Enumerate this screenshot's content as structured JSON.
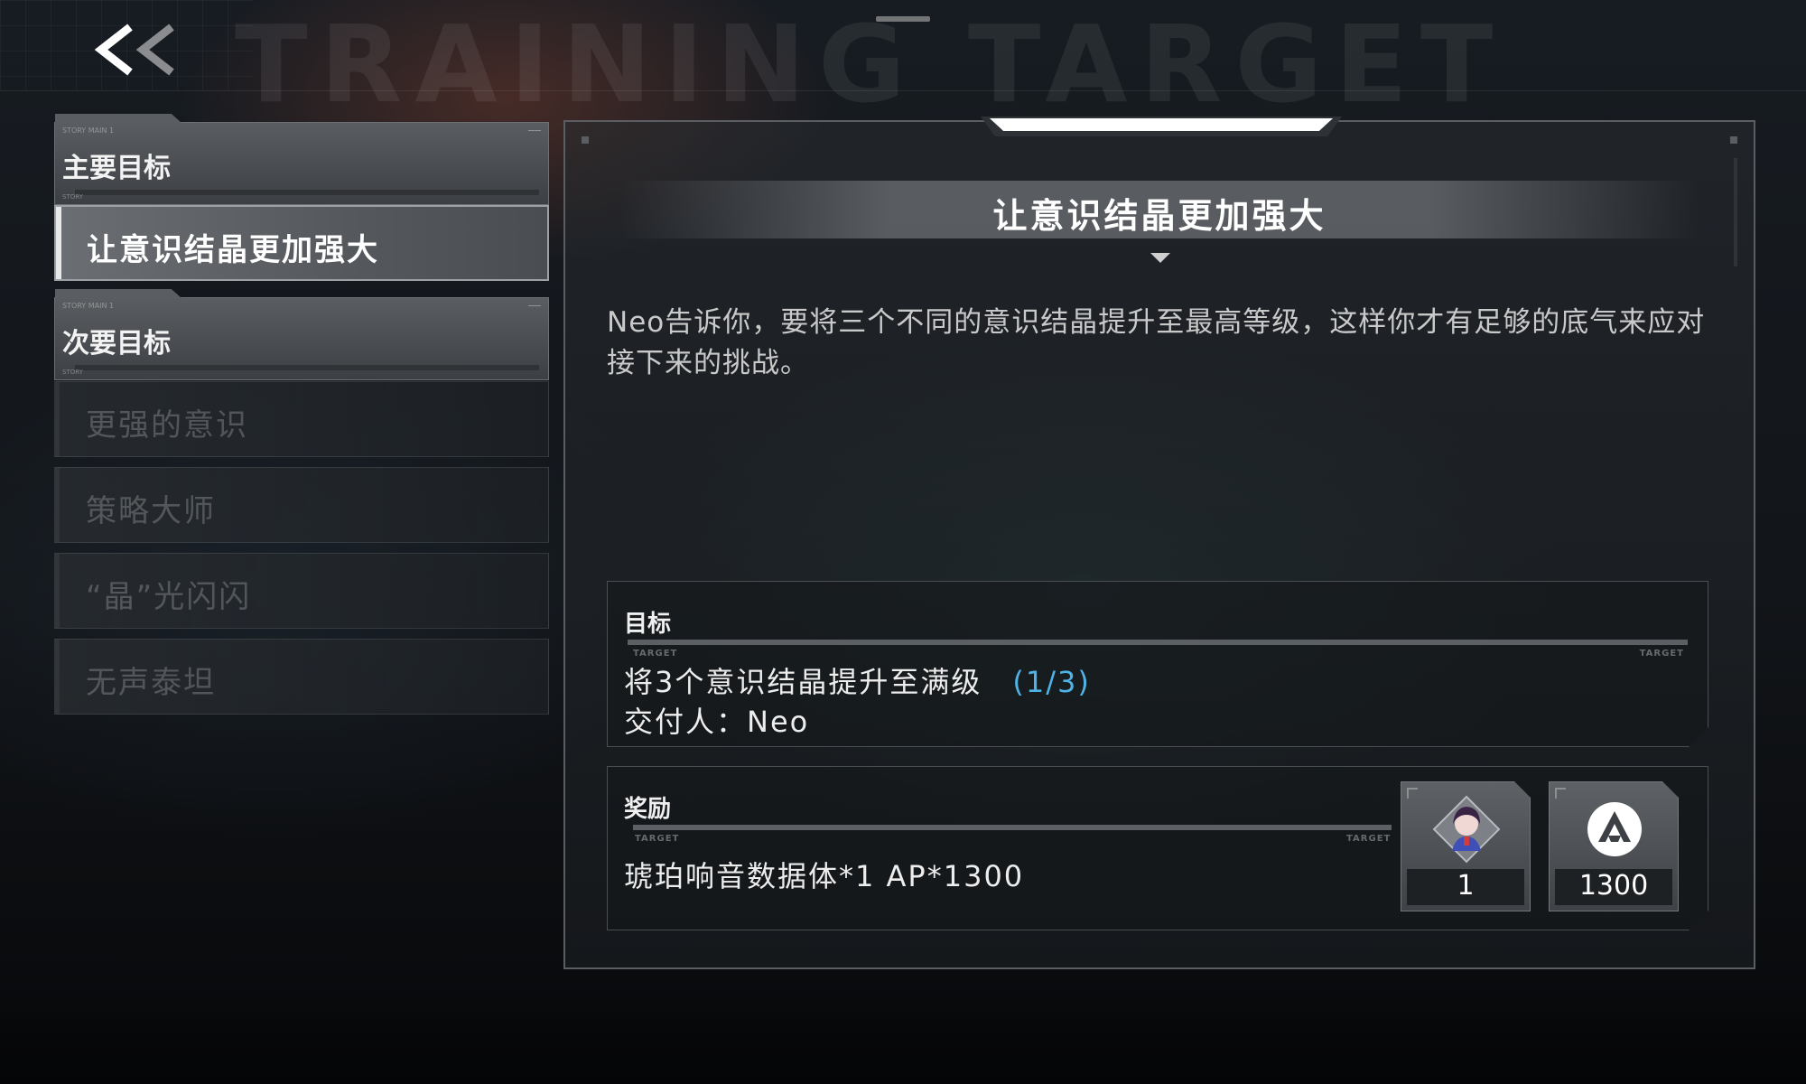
{
  "header": {
    "background_title": "TRAINING TARGET",
    "back_icon": "double-chevron-left-icon"
  },
  "sidebar": {
    "main_section": {
      "label": "主要目标",
      "micro_top": "STORY MAIN 1",
      "micro_bottom": "STORY"
    },
    "main_items": [
      {
        "label": "让意识结晶更加强大",
        "selected": true
      }
    ],
    "secondary_section": {
      "label": "次要目标",
      "micro_top": "STORY MAIN 1",
      "micro_bottom": "STORY"
    },
    "secondary_items": [
      {
        "label": "更强的意识",
        "selected": false
      },
      {
        "label": "策略大师",
        "selected": false
      },
      {
        "label": "“晶”光闪闪",
        "selected": false
      },
      {
        "label": "无声泰坦",
        "selected": false
      }
    ]
  },
  "detail": {
    "title": "让意识结晶更加强大",
    "description": "Neo告诉你，要将三个不同的意识结晶提升至最高等级，这样你才有足够的底气来应对接下来的挑战。",
    "objective": {
      "heading": "目标",
      "tag_left": "TARGET",
      "tag_right": "TARGET",
      "text": "将3个意识结晶提升至满级",
      "progress": "(1/3)",
      "giver_label": "交付人：",
      "giver": "Neo"
    },
    "reward": {
      "heading": "奖励",
      "tag_left": "TARGET",
      "tag_right": "TARGET",
      "text": "琥珀响音数据体*1  AP*1300",
      "items": [
        {
          "icon": "character-portrait-icon",
          "qty": "1"
        },
        {
          "icon": "ap-logo-icon",
          "qty": "1300"
        }
      ]
    }
  },
  "colors": {
    "accent_progress": "#4fb3e8",
    "selected_bg": "#6b6e72",
    "panel_border": "#5a5e62"
  }
}
